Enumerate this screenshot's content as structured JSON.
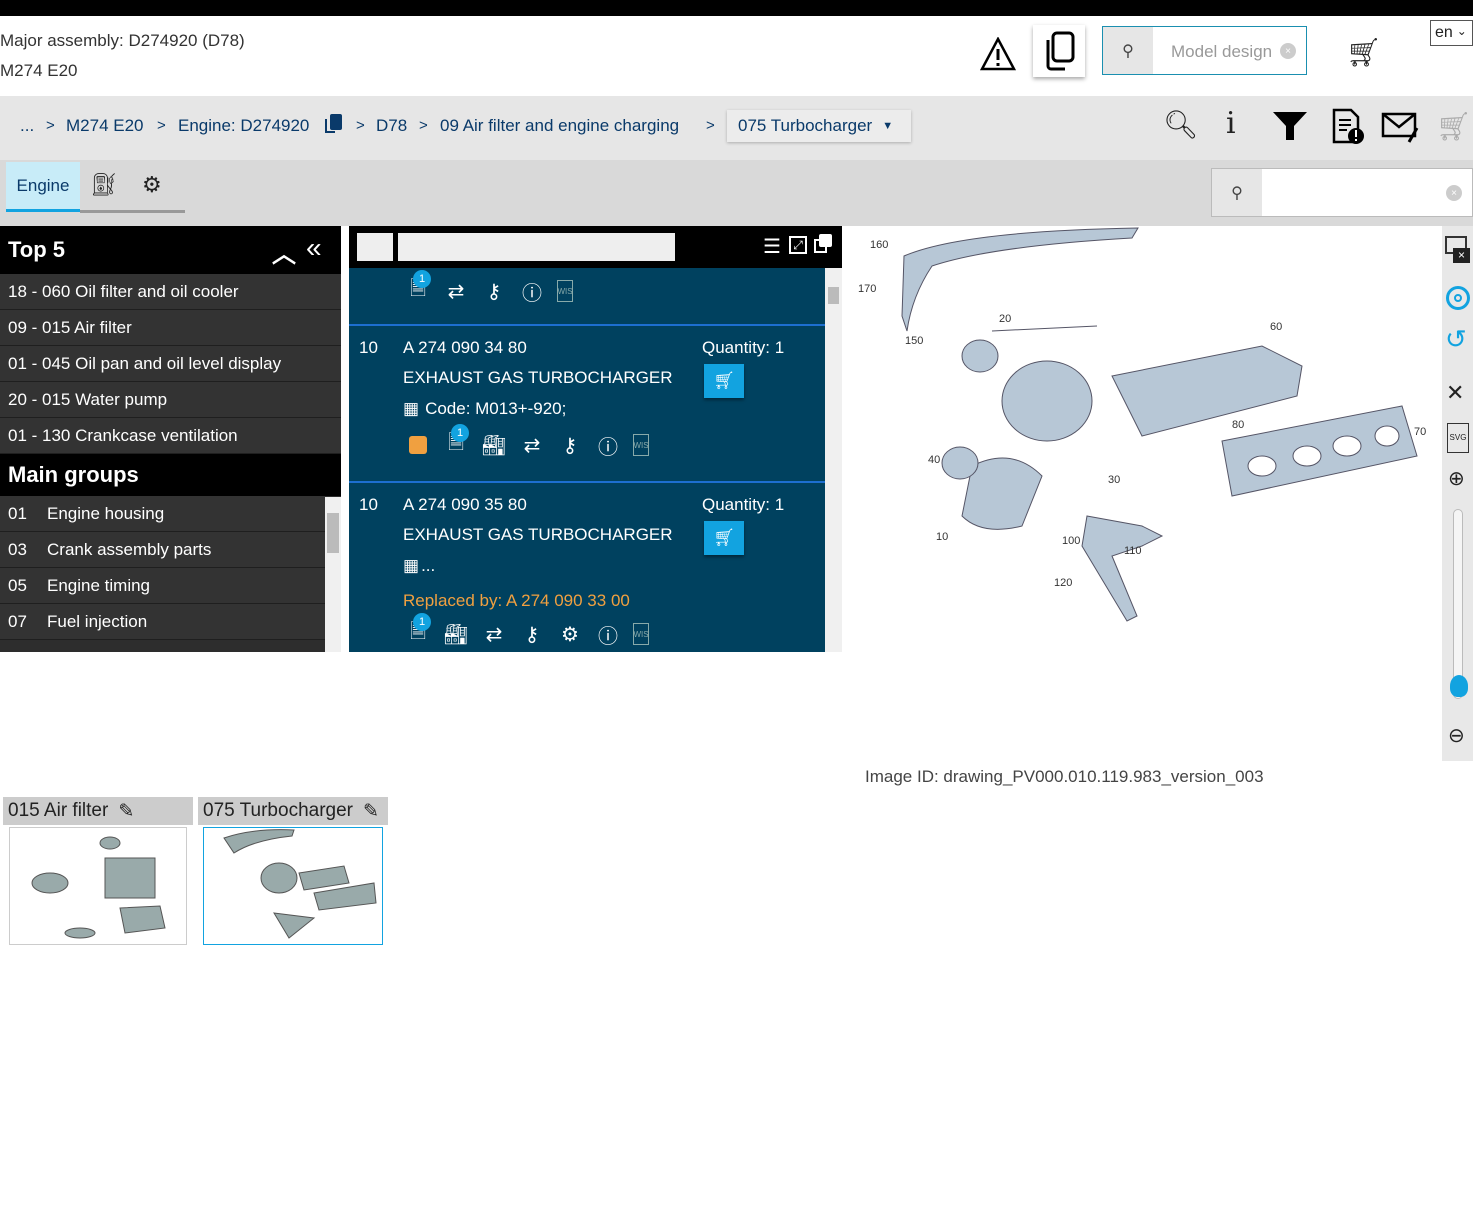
{
  "header": {
    "major_assembly": "Major assembly: D274920 (D78)",
    "model": "M274 E20",
    "search_placeholder": "Model design",
    "language": "en"
  },
  "breadcrumb": {
    "items": [
      "...",
      "M274 E20",
      "Engine: D274920",
      "D78",
      "09 Air filter and engine charging"
    ],
    "current": "075 Turbocharger",
    "separator": ">"
  },
  "tabs": {
    "engine": "Engine"
  },
  "top5": {
    "title": "Top 5",
    "items": [
      "18 - 060 Oil filter and oil cooler",
      "09 - 015 Air filter",
      "01 - 045 Oil pan and oil level display",
      "20 - 015 Water pump",
      "01 - 130 Crankcase ventilation"
    ]
  },
  "main_groups": {
    "title": "Main groups",
    "items": [
      {
        "num": "01",
        "label": "Engine housing"
      },
      {
        "num": "03",
        "label": "Crank assembly parts"
      },
      {
        "num": "05",
        "label": "Engine timing"
      },
      {
        "num": "07",
        "label": "Fuel injection"
      }
    ]
  },
  "parts": [
    {
      "pos": "10",
      "number": "A 274 090 34 80",
      "name": "EXHAUST GAS TURBOCHARGER",
      "quantity": "Quantity: 1",
      "code": "Code: M013+-920;",
      "badge": "1"
    },
    {
      "pos": "10",
      "number": "A 274 090 35 80",
      "name": "EXHAUST GAS TURBOCHARGER",
      "quantity": "Quantity: 1",
      "code": "...",
      "replaced": "Replaced by: A 274 090 33 00",
      "badge": "1"
    }
  ],
  "top_partial_badge": "1",
  "wis_label": "WIS",
  "drawing": {
    "callouts": [
      "160",
      "170",
      "150",
      "20",
      "60",
      "80",
      "70",
      "40",
      "30",
      "10",
      "100",
      "110",
      "120"
    ],
    "image_id": "Image ID: drawing_PV000.010.119.983_version_003",
    "svg_label": "SVG",
    "zoom_level": 0
  },
  "thumbnails": [
    {
      "label": "015 Air filter"
    },
    {
      "label": "075 Turbocharger"
    }
  ],
  "colors": {
    "panel": "#00415f",
    "accent": "#12a3e0",
    "replaced": "#f0a040"
  }
}
